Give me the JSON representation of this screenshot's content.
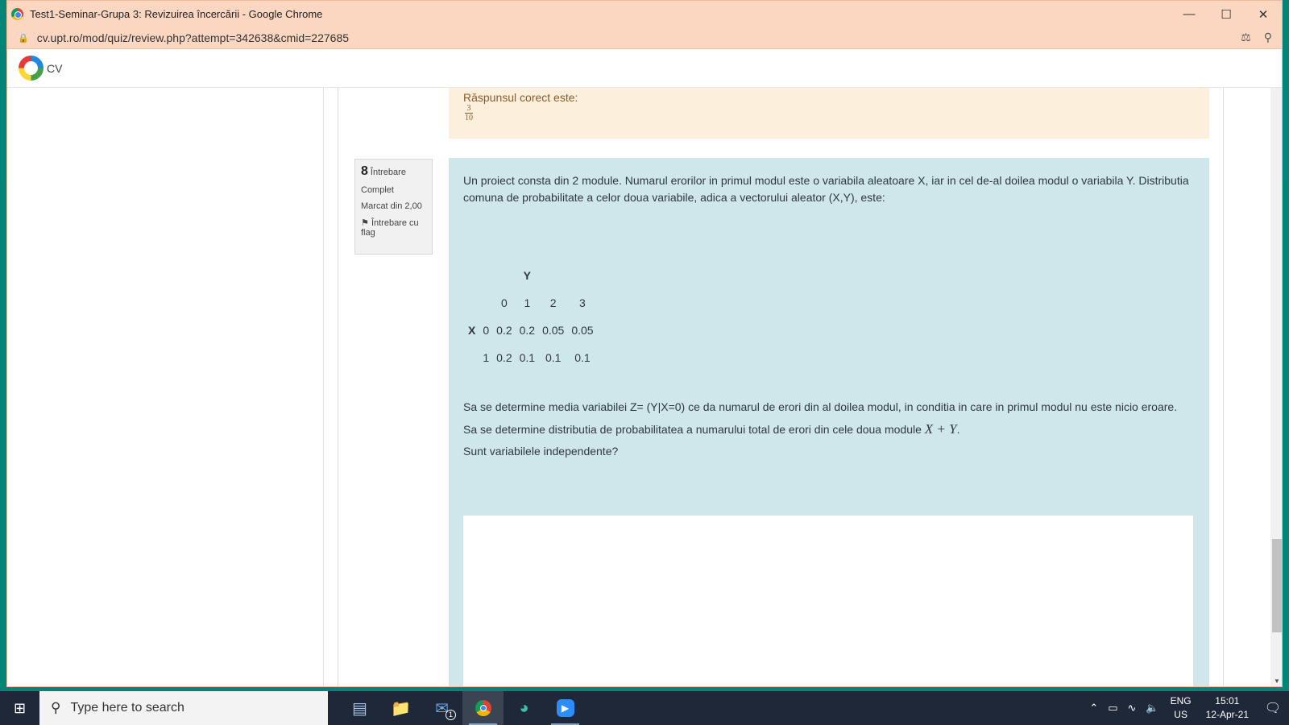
{
  "window": {
    "title": "Test1-Seminar-Grupa 3: Revizuirea încercării - Google Chrome"
  },
  "address": {
    "url": "cv.upt.ro/mod/quiz/review.php?attempt=342638&cmid=227685"
  },
  "site": {
    "name": "CV"
  },
  "prev_answer": {
    "label": "Răspunsul corect este:",
    "numerator": "3",
    "denominator": "10"
  },
  "question": {
    "number": "8",
    "number_label": "Întrebare",
    "state": "Complet",
    "mark": "Marcat din 2,00",
    "flag": "Întrebare cu flag",
    "intro": "Un proiect consta din 2 module. Numarul erorilor in primul modul este  o variabila aleatoare X, iar in cel de-al doilea modul o variabila Y. Distributia comuna de probabilitate a celor doua variabile, adica a vectorului aleator (X,Y), este:",
    "table": {
      "y_label": "Y",
      "x_label": "X",
      "y_values": [
        "0",
        "1",
        "2",
        "3"
      ],
      "rows": [
        {
          "x": "0",
          "cells": [
            "0.2",
            "0.2",
            "0.05",
            "0.05"
          ]
        },
        {
          "x": "1",
          "cells": [
            "0.2",
            "0.1",
            "0.1",
            "0.1"
          ]
        }
      ]
    },
    "line1": " Sa se determine media variabilei Z= (Y|X=0) ce da numarul de erori din al doilea modul, in conditia in care in primul modul nu este nicio eroare.",
    "line2": "Sa se determine distributia de probabilitatea a numarului total de erori din cele doua module",
    "line2_math": "X + Y",
    "line2_end": ".",
    "line3": "Sunt variabilele independente?"
  },
  "taskbar": {
    "search_placeholder": "Type here to search",
    "lang": "ENG",
    "region": "US",
    "time": "15:01",
    "date": "12-Apr-21",
    "mail_badge": "1"
  }
}
